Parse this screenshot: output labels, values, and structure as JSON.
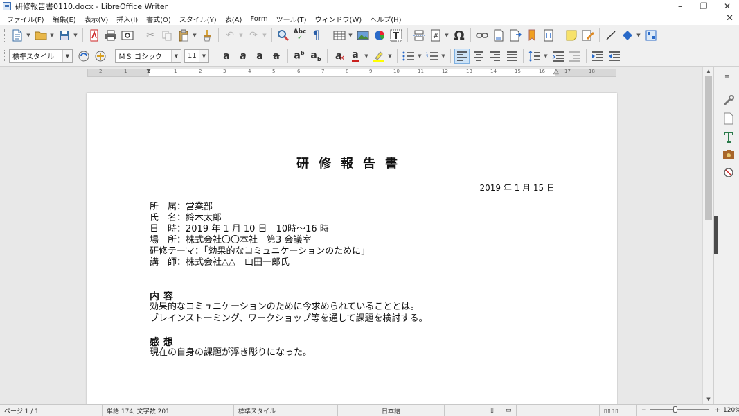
{
  "window": {
    "title": "研修報告書0110.docx - LibreOffice Writer",
    "controls": {
      "minimize": "–",
      "restore": "❐",
      "close": "✕"
    }
  },
  "menubar": {
    "items": [
      "ファイル(F)",
      "編集(E)",
      "表示(V)",
      "挿入(I)",
      "書式(O)",
      "スタイル(Y)",
      "表(A)",
      "Form",
      "ツール(T)",
      "ウィンドウ(W)",
      "ヘルプ(H)"
    ],
    "close_doc": "✕"
  },
  "formatting": {
    "paragraph_style": "標準スタイル",
    "font_name": "ＭＳ ゴシック",
    "font_size": "11"
  },
  "ruler": {
    "numbers": [
      "2",
      "1",
      "1",
      "2",
      "3",
      "4",
      "5",
      "6",
      "7",
      "8",
      "9",
      "10",
      "11",
      "12",
      "13",
      "14",
      "15",
      "16",
      "17",
      "18"
    ]
  },
  "document": {
    "title": "研修報告書",
    "date": "2019 年 1 月 15 日",
    "info_lines": [
      "所　属：営業部",
      "氏　名：鈴木太郎",
      "日　時：2019 年 1 月 10 日　10時～16 時",
      "場　所：株式会社〇〇本社　第3 会議室",
      "研修テーマ：「効果的なコミュニケーションのために」",
      "講　師：株式会社△△　山田一郎氏"
    ],
    "section1_heading": "内容",
    "section1_lines": [
      "効果的なコミュニケーションのために今求められていることとは。",
      "ブレインストーミング、ワークショップ等を通して課題を検討する。"
    ],
    "section2_heading": "感想",
    "section2_lines": [
      "現在の自身の課題が浮き彫りになった。"
    ]
  },
  "statusbar": {
    "page": "ページ 1 / 1",
    "word_count": "単語 174, 文字数 201",
    "page_style": "標準スタイル",
    "language": "日本語",
    "zoom_minus": "−",
    "zoom_plus": "+",
    "zoom": "120%"
  },
  "colors": {
    "toolbar_bg": "#f0f0f0",
    "active_button": "#cde3f7",
    "page_bg": "#ffffff",
    "workspace_bg": "#e8e8e8"
  }
}
